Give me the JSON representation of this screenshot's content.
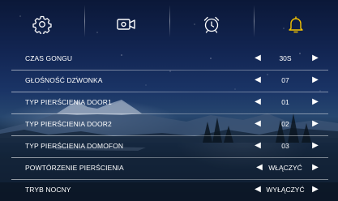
{
  "tabs": [
    {
      "icon": "gear-icon"
    },
    {
      "icon": "video-camera-icon"
    },
    {
      "icon": "alarm-clock-icon"
    },
    {
      "icon": "bell-icon",
      "active": true
    }
  ],
  "accent_color": "#f5c400",
  "settings": [
    {
      "label": "CZAS GONGU",
      "value": "30S"
    },
    {
      "label": "GŁOŚNOŚĆ DZWONKA",
      "value": "07"
    },
    {
      "label": "TYP PIERŚCIENIA DOOR1",
      "value": "01"
    },
    {
      "label": "TYP PIERŚCIENIA DOOR2",
      "value": "02"
    },
    {
      "label": "TYP PIERŚCIENIA DOMOFON",
      "value": "03"
    },
    {
      "label": "POWTÓRZENIE PIERŚCIENIA",
      "value": "WŁĄCZYĆ"
    },
    {
      "label": "TRYB NOCNY",
      "value": "WYŁĄCZYĆ"
    }
  ],
  "arrows": {
    "left": "◀",
    "right": "▶"
  }
}
